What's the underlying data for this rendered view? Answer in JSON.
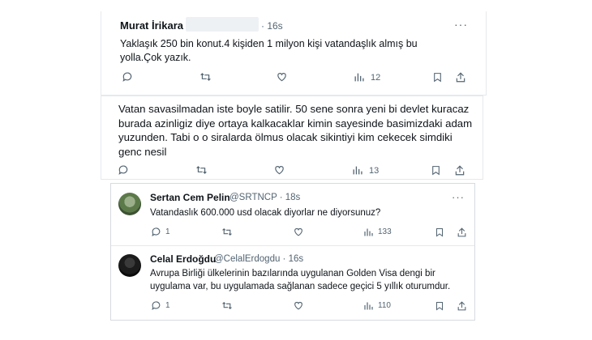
{
  "tweet1": {
    "name": "Murat İrikara",
    "time": "· 16s",
    "text_lines": [
      "Yaklaşık 250 bin konut.4 kişiden 1 milyon kişi vatandaşlık almış bu",
      "yolla.Çok yazık."
    ],
    "views": "12"
  },
  "tweet2": {
    "text_lines": [
      "Vatan savasilmadan iste boyle satilir. 50 sene sonra yeni bi devlet kuracaz",
      "burada azinligiz diye ortaya kalkacaklar kimin sayesinde basimizdaki adam",
      "yuzunden. Tabi o o siralarda ölmus olacak sikintiyi kim cekecek simdiki",
      "genc nesil"
    ],
    "views": "13"
  },
  "reply1": {
    "name": "Sertan Cem Pelin",
    "handle": "@SRTNCP · 18s",
    "text": "Vatandaslık 600.000 usd olacak diyorlar ne diyorsunuz?",
    "replies": "1",
    "views": "133"
  },
  "reply2": {
    "name": "Celal Erdoğdu",
    "handle": "@CelalErdogdu · 16s",
    "text_lines": [
      "Avrupa Birliği ülkelerinin bazılarında uygulanan Golden Visa dengi bir",
      "uygulama var, bu uygulamada sağlanan sadece geçici 5 yıllık oturumdur."
    ],
    "replies": "1",
    "views": "110"
  },
  "more_label": "···",
  "icons": [
    "reply-icon",
    "retweet-icon",
    "like-icon",
    "views-icon",
    "bookmark-icon",
    "share-icon"
  ],
  "colors": {
    "text": "#0f1419",
    "secondary": "#536471",
    "border": "#e6e9ec"
  }
}
